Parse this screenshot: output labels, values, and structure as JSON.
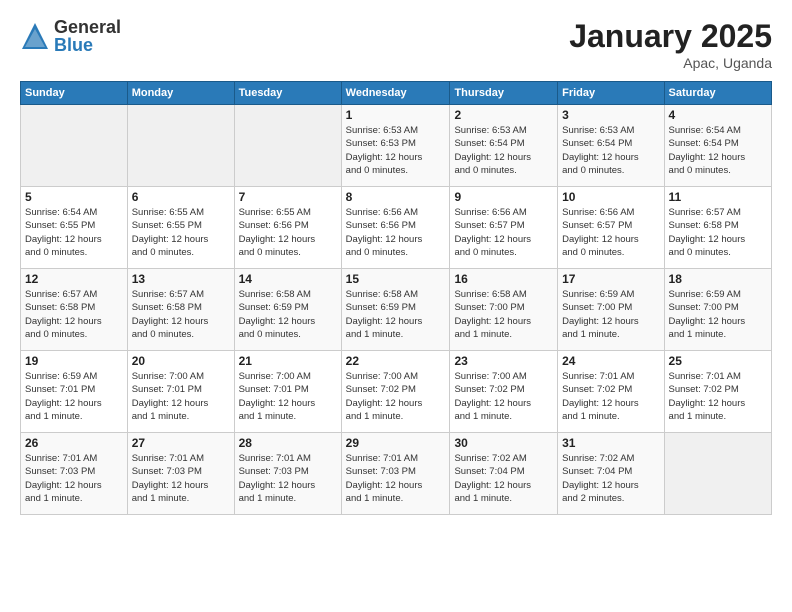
{
  "logo": {
    "general": "General",
    "blue": "Blue"
  },
  "header": {
    "title": "January 2025",
    "subtitle": "Apac, Uganda"
  },
  "weekdays": [
    "Sunday",
    "Monday",
    "Tuesday",
    "Wednesday",
    "Thursday",
    "Friday",
    "Saturday"
  ],
  "weeks": [
    [
      {
        "day": "",
        "info": ""
      },
      {
        "day": "",
        "info": ""
      },
      {
        "day": "",
        "info": ""
      },
      {
        "day": "1",
        "info": "Sunrise: 6:53 AM\nSunset: 6:53 PM\nDaylight: 12 hours\nand 0 minutes."
      },
      {
        "day": "2",
        "info": "Sunrise: 6:53 AM\nSunset: 6:54 PM\nDaylight: 12 hours\nand 0 minutes."
      },
      {
        "day": "3",
        "info": "Sunrise: 6:53 AM\nSunset: 6:54 PM\nDaylight: 12 hours\nand 0 minutes."
      },
      {
        "day": "4",
        "info": "Sunrise: 6:54 AM\nSunset: 6:54 PM\nDaylight: 12 hours\nand 0 minutes."
      }
    ],
    [
      {
        "day": "5",
        "info": "Sunrise: 6:54 AM\nSunset: 6:55 PM\nDaylight: 12 hours\nand 0 minutes."
      },
      {
        "day": "6",
        "info": "Sunrise: 6:55 AM\nSunset: 6:55 PM\nDaylight: 12 hours\nand 0 minutes."
      },
      {
        "day": "7",
        "info": "Sunrise: 6:55 AM\nSunset: 6:56 PM\nDaylight: 12 hours\nand 0 minutes."
      },
      {
        "day": "8",
        "info": "Sunrise: 6:56 AM\nSunset: 6:56 PM\nDaylight: 12 hours\nand 0 minutes."
      },
      {
        "day": "9",
        "info": "Sunrise: 6:56 AM\nSunset: 6:57 PM\nDaylight: 12 hours\nand 0 minutes."
      },
      {
        "day": "10",
        "info": "Sunrise: 6:56 AM\nSunset: 6:57 PM\nDaylight: 12 hours\nand 0 minutes."
      },
      {
        "day": "11",
        "info": "Sunrise: 6:57 AM\nSunset: 6:58 PM\nDaylight: 12 hours\nand 0 minutes."
      }
    ],
    [
      {
        "day": "12",
        "info": "Sunrise: 6:57 AM\nSunset: 6:58 PM\nDaylight: 12 hours\nand 0 minutes."
      },
      {
        "day": "13",
        "info": "Sunrise: 6:57 AM\nSunset: 6:58 PM\nDaylight: 12 hours\nand 0 minutes."
      },
      {
        "day": "14",
        "info": "Sunrise: 6:58 AM\nSunset: 6:59 PM\nDaylight: 12 hours\nand 0 minutes."
      },
      {
        "day": "15",
        "info": "Sunrise: 6:58 AM\nSunset: 6:59 PM\nDaylight: 12 hours\nand 1 minute."
      },
      {
        "day": "16",
        "info": "Sunrise: 6:58 AM\nSunset: 7:00 PM\nDaylight: 12 hours\nand 1 minute."
      },
      {
        "day": "17",
        "info": "Sunrise: 6:59 AM\nSunset: 7:00 PM\nDaylight: 12 hours\nand 1 minute."
      },
      {
        "day": "18",
        "info": "Sunrise: 6:59 AM\nSunset: 7:00 PM\nDaylight: 12 hours\nand 1 minute."
      }
    ],
    [
      {
        "day": "19",
        "info": "Sunrise: 6:59 AM\nSunset: 7:01 PM\nDaylight: 12 hours\nand 1 minute."
      },
      {
        "day": "20",
        "info": "Sunrise: 7:00 AM\nSunset: 7:01 PM\nDaylight: 12 hours\nand 1 minute."
      },
      {
        "day": "21",
        "info": "Sunrise: 7:00 AM\nSunset: 7:01 PM\nDaylight: 12 hours\nand 1 minute."
      },
      {
        "day": "22",
        "info": "Sunrise: 7:00 AM\nSunset: 7:02 PM\nDaylight: 12 hours\nand 1 minute."
      },
      {
        "day": "23",
        "info": "Sunrise: 7:00 AM\nSunset: 7:02 PM\nDaylight: 12 hours\nand 1 minute."
      },
      {
        "day": "24",
        "info": "Sunrise: 7:01 AM\nSunset: 7:02 PM\nDaylight: 12 hours\nand 1 minute."
      },
      {
        "day": "25",
        "info": "Sunrise: 7:01 AM\nSunset: 7:02 PM\nDaylight: 12 hours\nand 1 minute."
      }
    ],
    [
      {
        "day": "26",
        "info": "Sunrise: 7:01 AM\nSunset: 7:03 PM\nDaylight: 12 hours\nand 1 minute."
      },
      {
        "day": "27",
        "info": "Sunrise: 7:01 AM\nSunset: 7:03 PM\nDaylight: 12 hours\nand 1 minute."
      },
      {
        "day": "28",
        "info": "Sunrise: 7:01 AM\nSunset: 7:03 PM\nDaylight: 12 hours\nand 1 minute."
      },
      {
        "day": "29",
        "info": "Sunrise: 7:01 AM\nSunset: 7:03 PM\nDaylight: 12 hours\nand 1 minute."
      },
      {
        "day": "30",
        "info": "Sunrise: 7:02 AM\nSunset: 7:04 PM\nDaylight: 12 hours\nand 1 minute."
      },
      {
        "day": "31",
        "info": "Sunrise: 7:02 AM\nSunset: 7:04 PM\nDaylight: 12 hours\nand 2 minutes."
      },
      {
        "day": "",
        "info": ""
      }
    ]
  ]
}
